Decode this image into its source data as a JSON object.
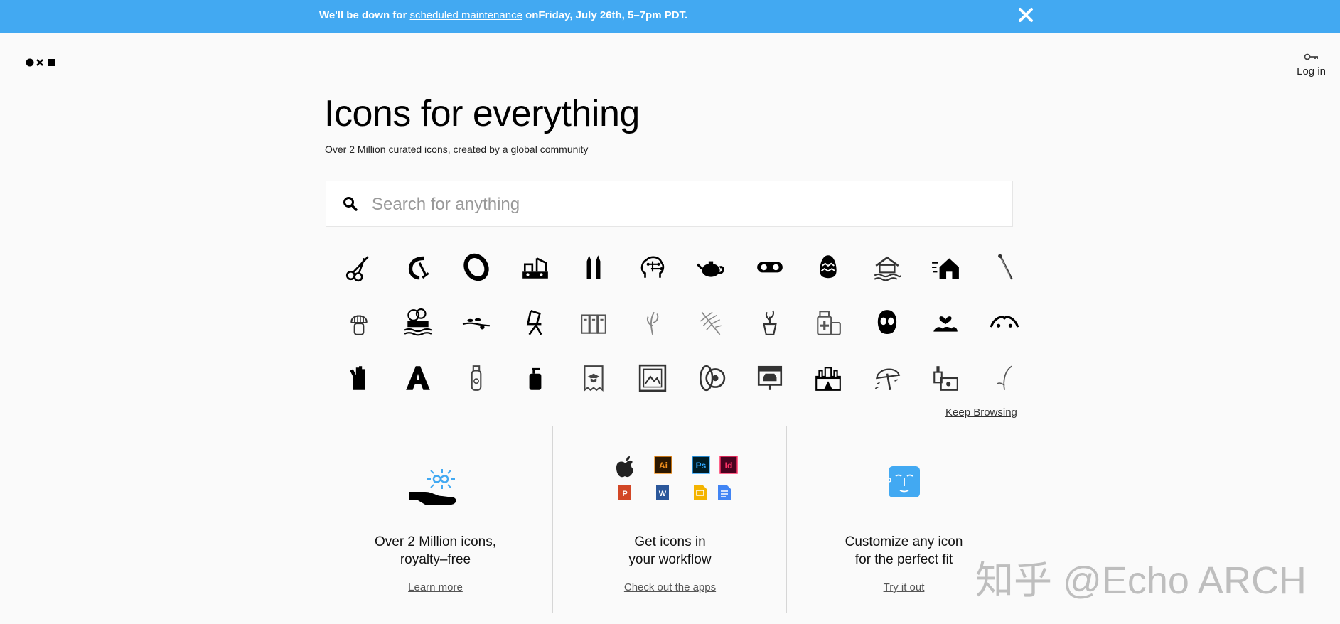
{
  "banner": {
    "prefix": "We'll be down for ",
    "link": "scheduled maintenance",
    "suffix": " onFriday, July 26th, 5–7pm PDT.",
    "close_icon": "close-icon",
    "background": "#42a9f2"
  },
  "header": {
    "logo_icon": "noun-project-logo",
    "login_icon": "key-icon",
    "login_label": "Log in"
  },
  "hero": {
    "title": "Icons for everything",
    "subtitle": "Over 2 Million curated icons, created by a global community"
  },
  "search": {
    "placeholder": "Search for anything",
    "value": "",
    "icon": "search-icon"
  },
  "icon_grid": [
    "scissors-icon",
    "clamp-icon",
    "bracelet-icon",
    "oil-rig-icon",
    "pencils-icon",
    "brain-network-icon",
    "teapot-icon",
    "cassette-icon",
    "egg-icon",
    "flooded-house-icon",
    "windy-house-icon",
    "pin-icon",
    "shaving-brush-icon",
    "factory-pollution-icon",
    "branch-icon",
    "folding-chair-icon",
    "binders-icon",
    "plant-sprout-icon",
    "palm-leaf-icon",
    "potted-plant-icon",
    "medicine-bottle-icon",
    "mask-icon",
    "heart-speech-icon",
    "chain-icon",
    "hand-icon",
    "mountain-letter-icon",
    "lotion-bottle-icon",
    "soap-dispenser-icon",
    "diploma-receipt-icon",
    "landscape-frame-icon",
    "tire-icon",
    "car-sign-icon",
    "temple-icon",
    "beach-umbrella-icon",
    "drinks-icon",
    "leaf-icon"
  ],
  "keep_browsing": "Keep Browsing",
  "features": [
    {
      "title_line1": "Over 2 Million icons,",
      "title_line2": "royalty–free",
      "link": "Learn more",
      "icon": "hand-infinity-icon"
    },
    {
      "title_line1": "Get icons in",
      "title_line2": "your workflow",
      "link": "Check out the apps",
      "icon": "app-icons"
    },
    {
      "title_line1": "Customize any icon",
      "title_line2": "for the perfect fit",
      "link": "Try it out",
      "icon": "face-icon"
    }
  ],
  "apps": [
    "Ai",
    "Ps",
    "Id",
    "P",
    "W"
  ],
  "watermark": "知乎 @Echo ARCH"
}
